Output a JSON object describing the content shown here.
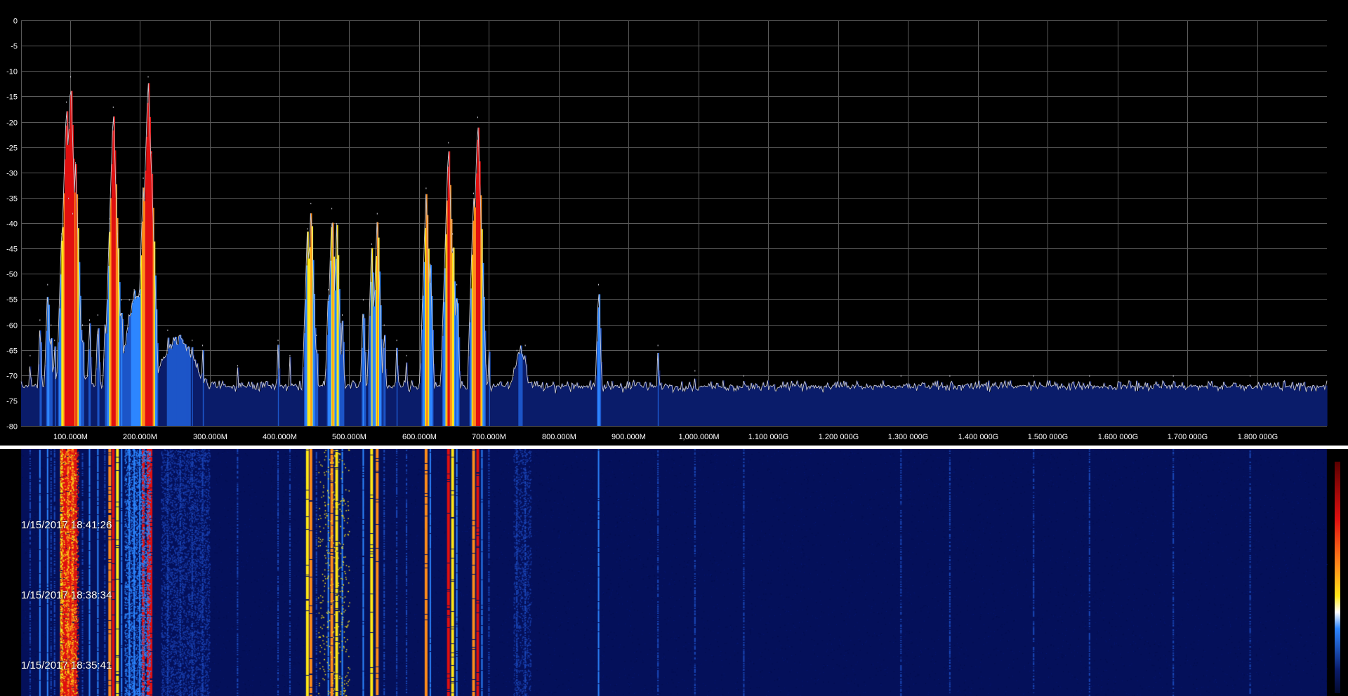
{
  "spectrum": {
    "y_ticks": [
      "0",
      "-5",
      "-10",
      "-15",
      "-20",
      "-25",
      "-30",
      "-35",
      "-40",
      "-45",
      "-50",
      "-55",
      "-60",
      "-65",
      "-70",
      "-75",
      "-80"
    ],
    "x_ticks": [
      "100.000M",
      "200.000M",
      "300.000M",
      "400.000M",
      "500.000M",
      "600.000M",
      "700.000M",
      "800.000M",
      "900.000M",
      "1,000.000M",
      "1.100 000G",
      "1.200 000G",
      "1.300 000G",
      "1.400 000G",
      "1.500 000G",
      "1.600 000G",
      "1.700 000G",
      "1.800 000G"
    ]
  },
  "waterfall": {
    "timestamps": [
      "1/15/2017 18:41:26",
      "1/15/2017 18:38:34",
      "1/15/2017 18:35:41"
    ]
  },
  "colors": {
    "background": "#000000",
    "grid": "#5a5a5a",
    "trace": "#c8c8d0",
    "noise_fill": "#0a1c6a",
    "waterfall_bg": "#04105a",
    "hot_red": "#e01010",
    "hot_orange": "#ff8c1a",
    "hot_yellow": "#ffe617",
    "cool_blue": "#2d86ff"
  },
  "chart_data": {
    "type": "area",
    "xlabel": "",
    "ylabel": "",
    "x_unit": "MHz",
    "xlim": [
      30,
      1900
    ],
    "ylim": [
      -80,
      0
    ],
    "grid": true,
    "noise_floor_db": -73,
    "peaks": [
      {
        "freq": 43,
        "db": -66
      },
      {
        "freq": 57,
        "db": -59
      },
      {
        "freq": 68,
        "db": -52
      },
      {
        "freq": 73,
        "db": -60
      },
      {
        "freq": 78,
        "db": -63
      },
      {
        "freq": 88,
        "db": -42
      },
      {
        "freq": 92,
        "db": -30
      },
      {
        "freq": 95,
        "db": -16
      },
      {
        "freq": 98,
        "db": -35
      },
      {
        "freq": 101,
        "db": -11
      },
      {
        "freq": 104,
        "db": -38
      },
      {
        "freq": 108,
        "db": -28
      },
      {
        "freq": 118,
        "db": -60
      },
      {
        "freq": 128,
        "db": -59
      },
      {
        "freq": 140,
        "db": -58
      },
      {
        "freq": 150,
        "db": -60
      },
      {
        "freq": 157,
        "db": -39
      },
      {
        "freq": 162,
        "db": -17
      },
      {
        "freq": 168,
        "db": -42
      },
      {
        "freq": 174,
        "db": -55
      },
      {
        "freq": 185,
        "db": -55
      },
      {
        "freq": 192,
        "db": -53
      },
      {
        "freq": 200,
        "db": -54
      },
      {
        "freq": 205,
        "db": -31
      },
      {
        "freq": 212,
        "db": -11
      },
      {
        "freq": 216,
        "db": -26
      },
      {
        "freq": 240,
        "db": -61
      },
      {
        "freq": 258,
        "db": -62
      },
      {
        "freq": 275,
        "db": -63
      },
      {
        "freq": 290,
        "db": -64
      },
      {
        "freq": 340,
        "db": -68
      },
      {
        "freq": 398,
        "db": -63
      },
      {
        "freq": 415,
        "db": -66
      },
      {
        "freq": 440,
        "db": -41
      },
      {
        "freq": 445,
        "db": -36
      },
      {
        "freq": 453,
        "db": -62
      },
      {
        "freq": 470,
        "db": -53
      },
      {
        "freq": 475,
        "db": -37
      },
      {
        "freq": 482,
        "db": -40
      },
      {
        "freq": 490,
        "db": -58
      },
      {
        "freq": 520,
        "db": -55
      },
      {
        "freq": 532,
        "db": -44
      },
      {
        "freq": 540,
        "db": -38
      },
      {
        "freq": 550,
        "db": -60
      },
      {
        "freq": 568,
        "db": -63
      },
      {
        "freq": 582,
        "db": -66
      },
      {
        "freq": 610,
        "db": -33
      },
      {
        "freq": 616,
        "db": -48
      },
      {
        "freq": 642,
        "db": -24
      },
      {
        "freq": 648,
        "db": -42
      },
      {
        "freq": 654,
        "db": -52
      },
      {
        "freq": 678,
        "db": -34
      },
      {
        "freq": 684,
        "db": -19
      },
      {
        "freq": 690,
        "db": -55
      },
      {
        "freq": 700,
        "db": -65
      },
      {
        "freq": 740,
        "db": -65
      },
      {
        "freq": 752,
        "db": -64
      },
      {
        "freq": 857,
        "db": -52
      },
      {
        "freq": 942,
        "db": -64
      },
      {
        "freq": 995,
        "db": -69
      },
      {
        "freq": 1065,
        "db": -70
      },
      {
        "freq": 1290,
        "db": -70
      },
      {
        "freq": 1360,
        "db": -70
      },
      {
        "freq": 1480,
        "db": -70
      },
      {
        "freq": 1560,
        "db": -70
      },
      {
        "freq": 1680,
        "db": -70
      },
      {
        "freq": 1790,
        "db": -70
      }
    ]
  }
}
